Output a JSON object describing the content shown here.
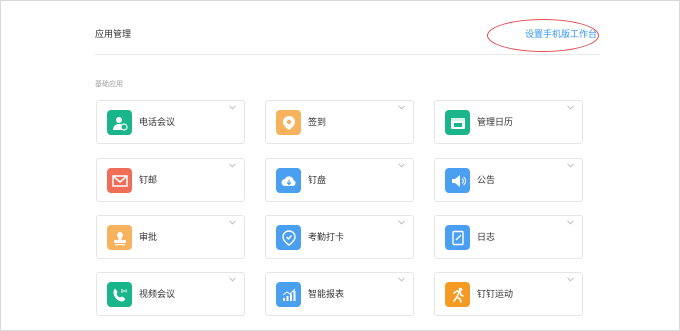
{
  "header": {
    "title": "应用管理",
    "mobile_link": "设置手机版工作台"
  },
  "section": {
    "label": "基础应用"
  },
  "apps": [
    {
      "label": "电话会议",
      "icon": "phone-meeting-icon",
      "color": "#1bb58b"
    },
    {
      "label": "签到",
      "icon": "location-pin-icon",
      "color": "#f6b25c"
    },
    {
      "label": "管理日历",
      "icon": "calendar-icon",
      "color": "#1bb58b"
    },
    {
      "label": "钉邮",
      "icon": "mail-icon",
      "color": "#f06e58"
    },
    {
      "label": "钉盘",
      "icon": "cloud-drive-icon",
      "color": "#4a9ff0"
    },
    {
      "label": "公告",
      "icon": "megaphone-icon",
      "color": "#4a9ff0"
    },
    {
      "label": "审批",
      "icon": "approval-stamp-icon",
      "color": "#f6b25c"
    },
    {
      "label": "考勤打卡",
      "icon": "attendance-pin-icon",
      "color": "#4a9ff0"
    },
    {
      "label": "日志",
      "icon": "notebook-icon",
      "color": "#4a9ff0"
    },
    {
      "label": "视频会议",
      "icon": "video-call-icon",
      "color": "#1bb58b"
    },
    {
      "label": "智能报表",
      "icon": "bar-chart-icon",
      "color": "#4a9ff0"
    },
    {
      "label": "钉钉运动",
      "icon": "running-man-icon",
      "color": "#f59a23"
    }
  ]
}
